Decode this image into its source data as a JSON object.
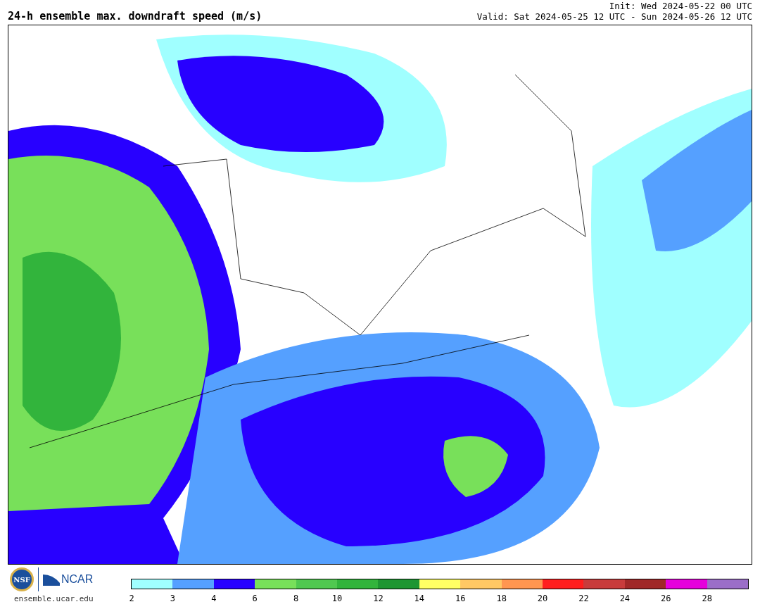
{
  "title": "24-h ensemble max. downdraft speed (m/s)",
  "init": "Init: Wed 2024-05-22 00 UTC",
  "valid": "Valid: Sat 2024-05-25 12 UTC - Sun 2024-05-26 12 UTC",
  "logos": {
    "nsf": "NSF",
    "ncar": "NCAR",
    "url": "ensemble.ucar.edu"
  },
  "colorbar": [
    {
      "label": "2",
      "color": "#a0ffff"
    },
    {
      "label": "3",
      "color": "#55a0ff"
    },
    {
      "label": "4",
      "color": "#2800ff"
    },
    {
      "label": "6",
      "color": "#78e05a"
    },
    {
      "label": "8",
      "color": "#50c850"
    },
    {
      "label": "10",
      "color": "#32b43c"
    },
    {
      "label": "12",
      "color": "#1e9632"
    },
    {
      "label": "14",
      "color": "#ffff64"
    },
    {
      "label": "16",
      "color": "#ffc864"
    },
    {
      "label": "18",
      "color": "#ff9650"
    },
    {
      "label": "20",
      "color": "#ff1e1e"
    },
    {
      "label": "22",
      "color": "#c83c3c"
    },
    {
      "label": "24",
      "color": "#a02828"
    },
    {
      "label": "26",
      "color": "#e600dc"
    },
    {
      "label": "28",
      "color": "#9b6ec8"
    }
  ]
}
